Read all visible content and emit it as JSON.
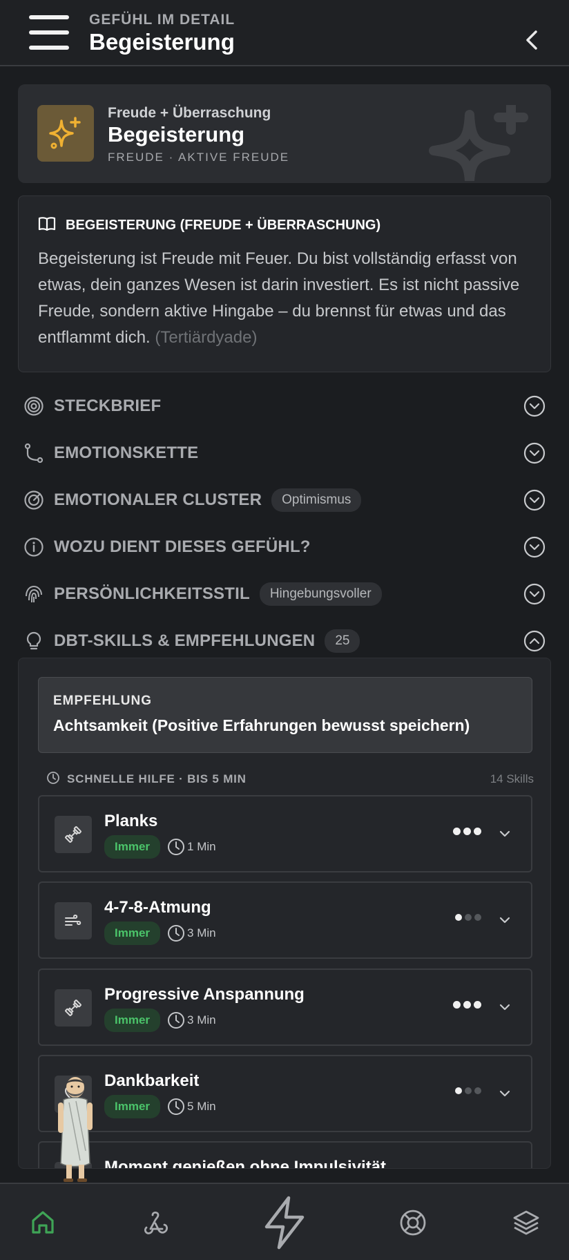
{
  "header": {
    "eyebrow": "GEFÜHL IM DETAIL",
    "title": "Begeisterung"
  },
  "hero": {
    "subtitle": "Freude + Überraschung",
    "title": "Begeisterung",
    "category": "FREUDE · AKTIVE FREUDE",
    "icon": "sparkles-icon",
    "accent_color": "#f0b132"
  },
  "description": {
    "heading": "BEGEISTERUNG (FREUDE + ÜBERRASCHUNG)",
    "text": "Begeisterung ist Freude mit Feuer. Du bist vollständig erfasst von etwas, dein ganzes Wesen ist darin investiert. Es ist nicht passive Freude, sondern aktive Hingabe – du brennst für etwas und das entflammt dich.",
    "muted": "(Tertiärdyade)"
  },
  "sections": [
    {
      "label": "STECKBRIEF",
      "icon": "target-icon"
    },
    {
      "label": "EMOTIONSKETTE",
      "icon": "route-icon"
    },
    {
      "label": "EMOTIONALER CLUSTER",
      "icon": "radar-icon",
      "chip": "Optimismus"
    },
    {
      "label": "WOZU DIENT DIESES GEFÜHL?",
      "icon": "info-icon"
    },
    {
      "label": "PERSÖNLICHKEITSSTIL",
      "icon": "fingerprint-icon",
      "chip": "Hingebungsvoller"
    },
    {
      "label": "DBT-SKILLS & EMPFEHLUNGEN",
      "icon": "lightbulb-icon",
      "chip": "25",
      "expanded": true
    }
  ],
  "dbt": {
    "recommendation_label": "EMPFEHLUNG",
    "recommendation_text": "Achtsamkeit (Positive Erfahrungen bewusst speichern)",
    "group_title": "SCHNELLE HILFE · BIS 5 MIN",
    "group_count": "14 Skills",
    "skills": [
      {
        "name": "Planks",
        "badge": "Immer",
        "duration": "1 Min",
        "icon": "dumbbell-icon",
        "intensity": 3
      },
      {
        "name": "4-7-8-Atmung",
        "badge": "Immer",
        "duration": "3 Min",
        "icon": "wind-icon",
        "intensity": 1
      },
      {
        "name": "Progressive Anspannung",
        "badge": "Immer",
        "duration": "3 Min",
        "icon": "dumbbell-icon",
        "intensity": 3
      },
      {
        "name": "Dankbarkeit",
        "badge": "Immer",
        "duration": "5 Min",
        "icon": "heart-icon",
        "intensity": 1
      },
      {
        "name": "Moment genießen ohne Impulsivität",
        "icon": "sparkle-icon"
      }
    ]
  },
  "nav": [
    {
      "name": "home",
      "icon": "home-icon",
      "active": true
    },
    {
      "name": "webhook",
      "icon": "webhook-icon"
    },
    {
      "name": "quick",
      "icon": "lightning-icon"
    },
    {
      "name": "help",
      "icon": "lifebuoy-icon"
    },
    {
      "name": "layers",
      "icon": "layers-icon"
    }
  ],
  "colors": {
    "background": "#1b1d20",
    "card": "#24262a",
    "active_nav": "#3fa456",
    "badge_green": "#4bc46a"
  }
}
